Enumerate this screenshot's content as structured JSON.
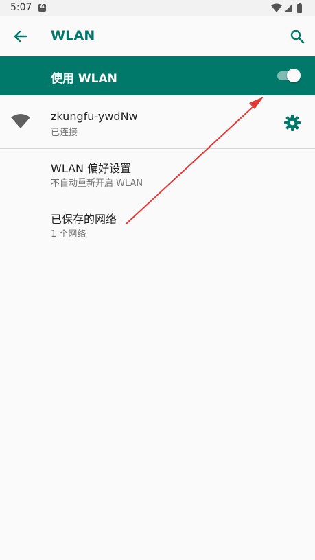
{
  "status_bar": {
    "time": "5:07",
    "notification_letter": "A"
  },
  "app_bar": {
    "title": "WLAN"
  },
  "master_switch": {
    "label": "使用 WLAN",
    "enabled": true
  },
  "connected_network": {
    "name": "zkungfu-ywdNw",
    "status": "已连接"
  },
  "preferences": [
    {
      "title": "WLAN 偏好设置",
      "subtitle": "不自动重新开启 WLAN"
    },
    {
      "title": "已保存的网络",
      "subtitle": "1 个网络"
    }
  ],
  "colors": {
    "accent": "#00796b",
    "annotation": "#e53935"
  },
  "icons": [
    "back-arrow-icon",
    "search-icon",
    "wifi-icon",
    "gear-icon",
    "signal-icon",
    "battery-icon"
  ]
}
